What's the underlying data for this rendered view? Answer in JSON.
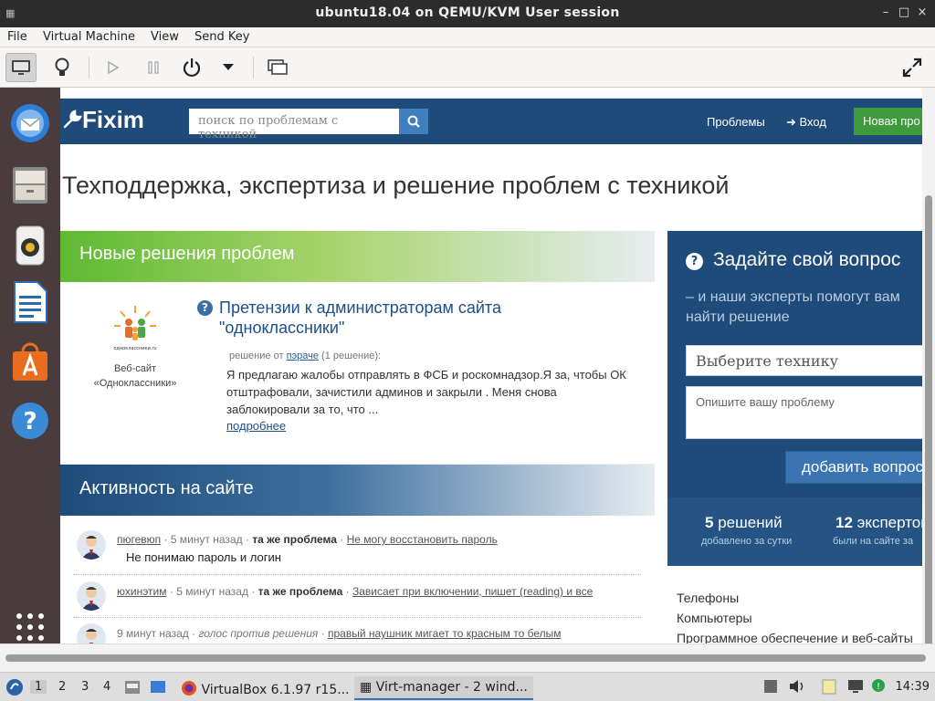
{
  "window": {
    "title": "ubuntu18.04 on QEMU/KVM User session",
    "app_icon": "virt-manager-icon"
  },
  "menubar": {
    "items": [
      "File",
      "Virtual Machine",
      "View",
      "Send Key"
    ]
  },
  "toolbar": {
    "icons": [
      "console-icon",
      "details-icon",
      "run-icon",
      "pause-icon",
      "power-icon",
      "dropdown-icon",
      "snapshots-icon",
      "fullscreen-icon"
    ]
  },
  "dock": {
    "apps": [
      "thunderbird-icon",
      "files-icon",
      "rhythmbox-icon",
      "libreoffice-writer-icon",
      "software-center-icon",
      "help-icon",
      "show-apps-icon"
    ]
  },
  "site": {
    "logo": "Fixim",
    "search_placeholder": "поиск по проблемам с техникой",
    "nav_problems": "Проблемы",
    "nav_login": "Вход",
    "new_problem": "Новая про",
    "page_title": "Техподдержка, экспертиза и решение проблем с техникой",
    "new_section": "Новые решения проблем",
    "card": {
      "logo_text": "одноклассники.ru",
      "caption_line1": "Веб-сайт",
      "caption_line2": "«Одноклассники»",
      "title": "Претензии к администраторам сайта \"одноклассники\"",
      "meta_prefix": "решение от",
      "meta_user": "пэраче",
      "meta_count": "(1 решение):",
      "text": "Я предлагаю жалобы отправлять в ФСБ и роскомнадзор.Я за, чтобы ОК отштрафовали, зачистили админов и закрыли . Меня снова заблокировали за то, что ...",
      "more": "подробнее"
    },
    "activity_section": "Активность на сайте",
    "activity": [
      {
        "user": "пюгевюп",
        "time": "· 5 минут назад ·",
        "tag": "та же проблема",
        "sep": "·",
        "link": "Не могу восстановить пароль",
        "comment": "Не понимаю пароль и логин"
      },
      {
        "user": "юхинэтим",
        "time": "· 5 минут назад ·",
        "tag": "та же проблема",
        "sep": "·",
        "link": "Зависает при включении, пишет (reading) и все",
        "comment": ""
      },
      {
        "time": "9 минут назад ·",
        "action": "голос против решения",
        "sep": "·",
        "link": "правый наушник мигает то красным то белым"
      }
    ],
    "ask": {
      "title": "Задайте свой вопрос",
      "subtitle": "– и наши эксперты помогут вам найти решение",
      "select_placeholder": "Выберите технику",
      "describe_placeholder": "Опишите вашу проблему",
      "add_button": "добавить вопрос"
    },
    "stats": [
      {
        "num": "5",
        "word": "решений",
        "sub": "добавлено за сутки"
      },
      {
        "num": "12",
        "word": "экспертов",
        "sub": "были на сайте за"
      }
    ],
    "categories": [
      "Телефоны",
      "Компьютеры",
      "Программное обеспечение и веб-сайты"
    ]
  },
  "taskbar": {
    "workspaces": [
      "1",
      "2",
      "3",
      "4"
    ],
    "tasks": [
      "VirtualBox 6.1.97 r15...",
      "Virt-manager - 2 wind..."
    ],
    "clock": "14:39"
  },
  "colors": {
    "header_blue": "#1e4b7a",
    "accent_green": "#5fb934",
    "button_green": "#3e9a3a",
    "dock_bg": "#4a3c3c"
  }
}
